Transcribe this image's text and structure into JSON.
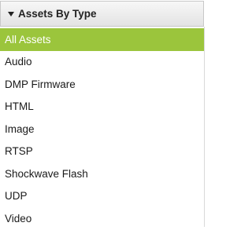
{
  "panel": {
    "title": "Assets By Type",
    "items": [
      {
        "label": "All Assets",
        "selected": true
      },
      {
        "label": "Audio",
        "selected": false
      },
      {
        "label": "DMP Firmware",
        "selected": false
      },
      {
        "label": "HTML",
        "selected": false
      },
      {
        "label": "Image",
        "selected": false
      },
      {
        "label": "RTSP",
        "selected": false
      },
      {
        "label": "Shockwave Flash",
        "selected": false
      },
      {
        "label": "UDP",
        "selected": false
      },
      {
        "label": "Video",
        "selected": false
      }
    ]
  },
  "colors": {
    "selected_background": "#9bc53c",
    "selected_text": "#ffffff",
    "text": "#1a1a1a"
  },
  "icons": {
    "header_toggle": "caret-down-icon"
  }
}
